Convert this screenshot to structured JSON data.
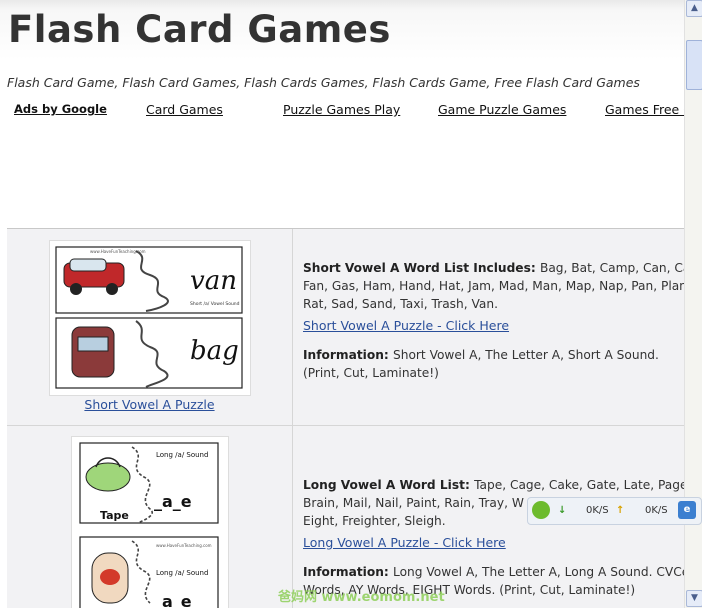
{
  "page": {
    "title": "Flash Card Games",
    "subtitle": "Flash Card Game, Flash Card Games, Flash Cards Games, Flash Cards Game, Free Flash Card Games"
  },
  "ads": {
    "label": "Ads by Google",
    "links": [
      "Card Games",
      "Puzzle Games Play",
      "Game Puzzle Games",
      "Games Free C"
    ]
  },
  "items": [
    {
      "thumbnail_words": [
        "van",
        "bag"
      ],
      "thumbnail_caption": "Short /a/ Vowel Sound",
      "thumbnail_site": "www.HaveFunTeaching.com",
      "caption_link": "Short Vowel A Puzzle",
      "word_list_heading": "Short Vowel A Word List Includes",
      "word_list_lines": [
        "Bag, Bat, Camp, Can, Cat, D",
        "Fan, Gas, Ham, Hand, Hat, Jam, Mad, Man, Map, Nap, Pan, Plan",
        "Rat, Sad, Sand, Taxi, Trash, Van."
      ],
      "puzzle_link": "Short Vowel A Puzzle - Click Here",
      "info_heading": "Information",
      "info_lines": [
        "Short Vowel A, The Letter A, Short A Sound.",
        "(Print, Cut, Laminate!)"
      ]
    },
    {
      "thumbnail_words": [
        "Tape",
        "_a_e"
      ],
      "thumbnail_caption": "Long /a/ Sound",
      "thumbnail_site": "www.HaveFunTeaching.com",
      "word_list_heading": "Long Vowel A Word List",
      "word_list_lines": [
        "Tape, Cage, Cake, Gate, Late, Page, S",
        "Brain, Mail, Nail, Paint, Rain, Tray, W",
        "Eight, Freighter, Sleigh."
      ],
      "puzzle_link": "Long Vowel A Puzzle - Click Here",
      "info_heading": "Information",
      "info_lines": [
        "Long Vowel A, The Letter A, Long A Sound. CVCe",
        "Words, AY Words, EIGHT Words. (Print, Cut, Laminate!)"
      ]
    }
  ],
  "speed_widget": {
    "down_rate": "0K/S",
    "up_rate": "0K/S"
  },
  "watermark": "爸妈网 www.eomom.net",
  "colors": {
    "link": "#2a4f9a",
    "row_bg": "#f2f2f4",
    "title": "#333333"
  }
}
